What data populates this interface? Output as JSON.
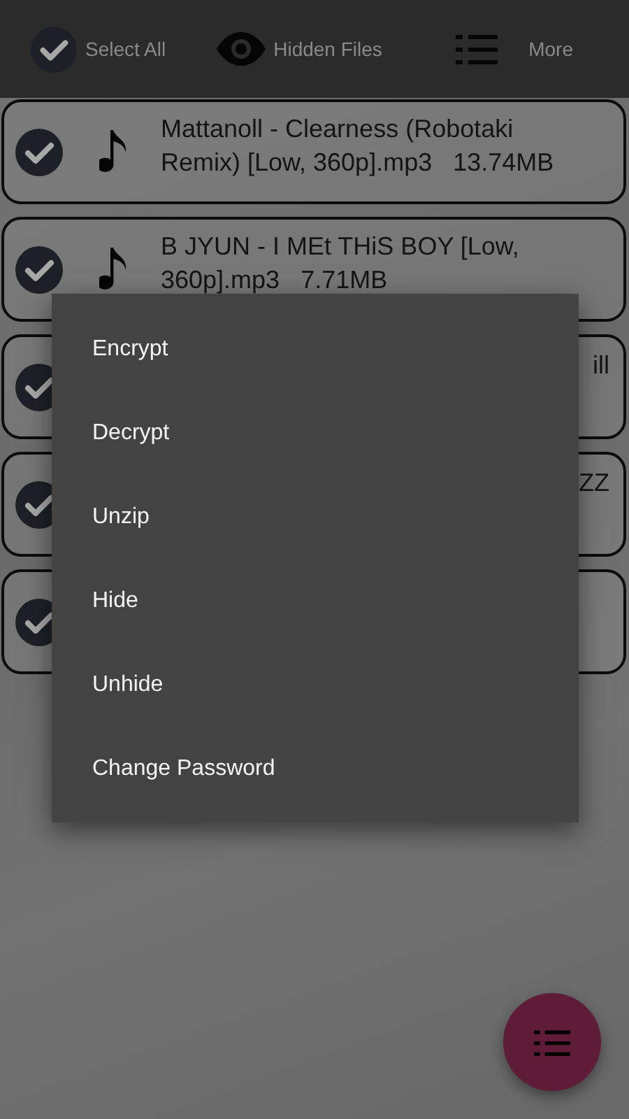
{
  "toolbar": [
    {
      "kind": "check",
      "label": "Select All"
    },
    {
      "kind": "eye",
      "label": "Hidden Files"
    },
    {
      "kind": "list",
      "label": "More"
    }
  ],
  "files": [
    {
      "kind": "full",
      "checked": true,
      "name": "Mattanoll - Clearness (Robotaki Remix) [Low, 360p].mp3",
      "size": "13.74MB"
    },
    {
      "kind": "full",
      "checked": true,
      "name": "B JYUN - I MEt THiS BOY [Low, 360p].mp3",
      "size": "7.71MB"
    },
    {
      "kind": "covered",
      "checked": true,
      "name": "ill"
    },
    {
      "kind": "covered",
      "checked": true,
      "name": "ZZ"
    },
    {
      "kind": "covered",
      "checked": true
    }
  ],
  "menu": {
    "items": [
      "Encrypt",
      "Decrypt",
      "Unzip",
      "Hide",
      "Unhide",
      "Change Password"
    ]
  },
  "fab": {
    "kind": "list"
  }
}
